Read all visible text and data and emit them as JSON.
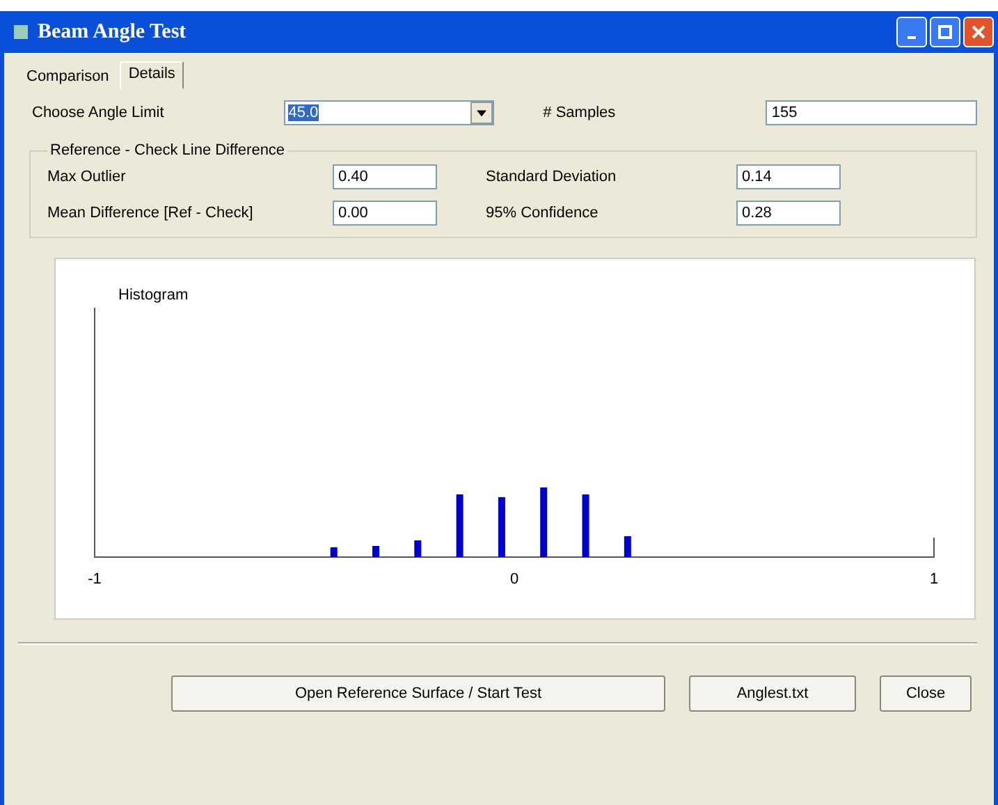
{
  "window": {
    "title": "Beam Angle Test"
  },
  "tabs": [
    {
      "label": "Comparison",
      "selected": false
    },
    {
      "label": "Details",
      "selected": true
    }
  ],
  "angle_limit": {
    "label": "Choose Angle Limit",
    "value": "45.0"
  },
  "samples": {
    "label": "# Samples",
    "value": "155"
  },
  "group": {
    "title": "Reference - Check Line Difference",
    "fields": [
      {
        "label": "Max Outlier",
        "value": "0.40"
      },
      {
        "label": "Standard Deviation",
        "value": "0.14"
      },
      {
        "label": "Mean Difference [Ref - Check]",
        "value": "0.00"
      },
      {
        "label": "95% Confidence",
        "value": "0.28"
      }
    ]
  },
  "histogram": {
    "title": "Histogram",
    "tick_labels": [
      "-1",
      "0",
      "1"
    ]
  },
  "buttons": [
    "Open Reference Surface / Start Test",
    "Anglest.txt",
    "Close"
  ]
}
